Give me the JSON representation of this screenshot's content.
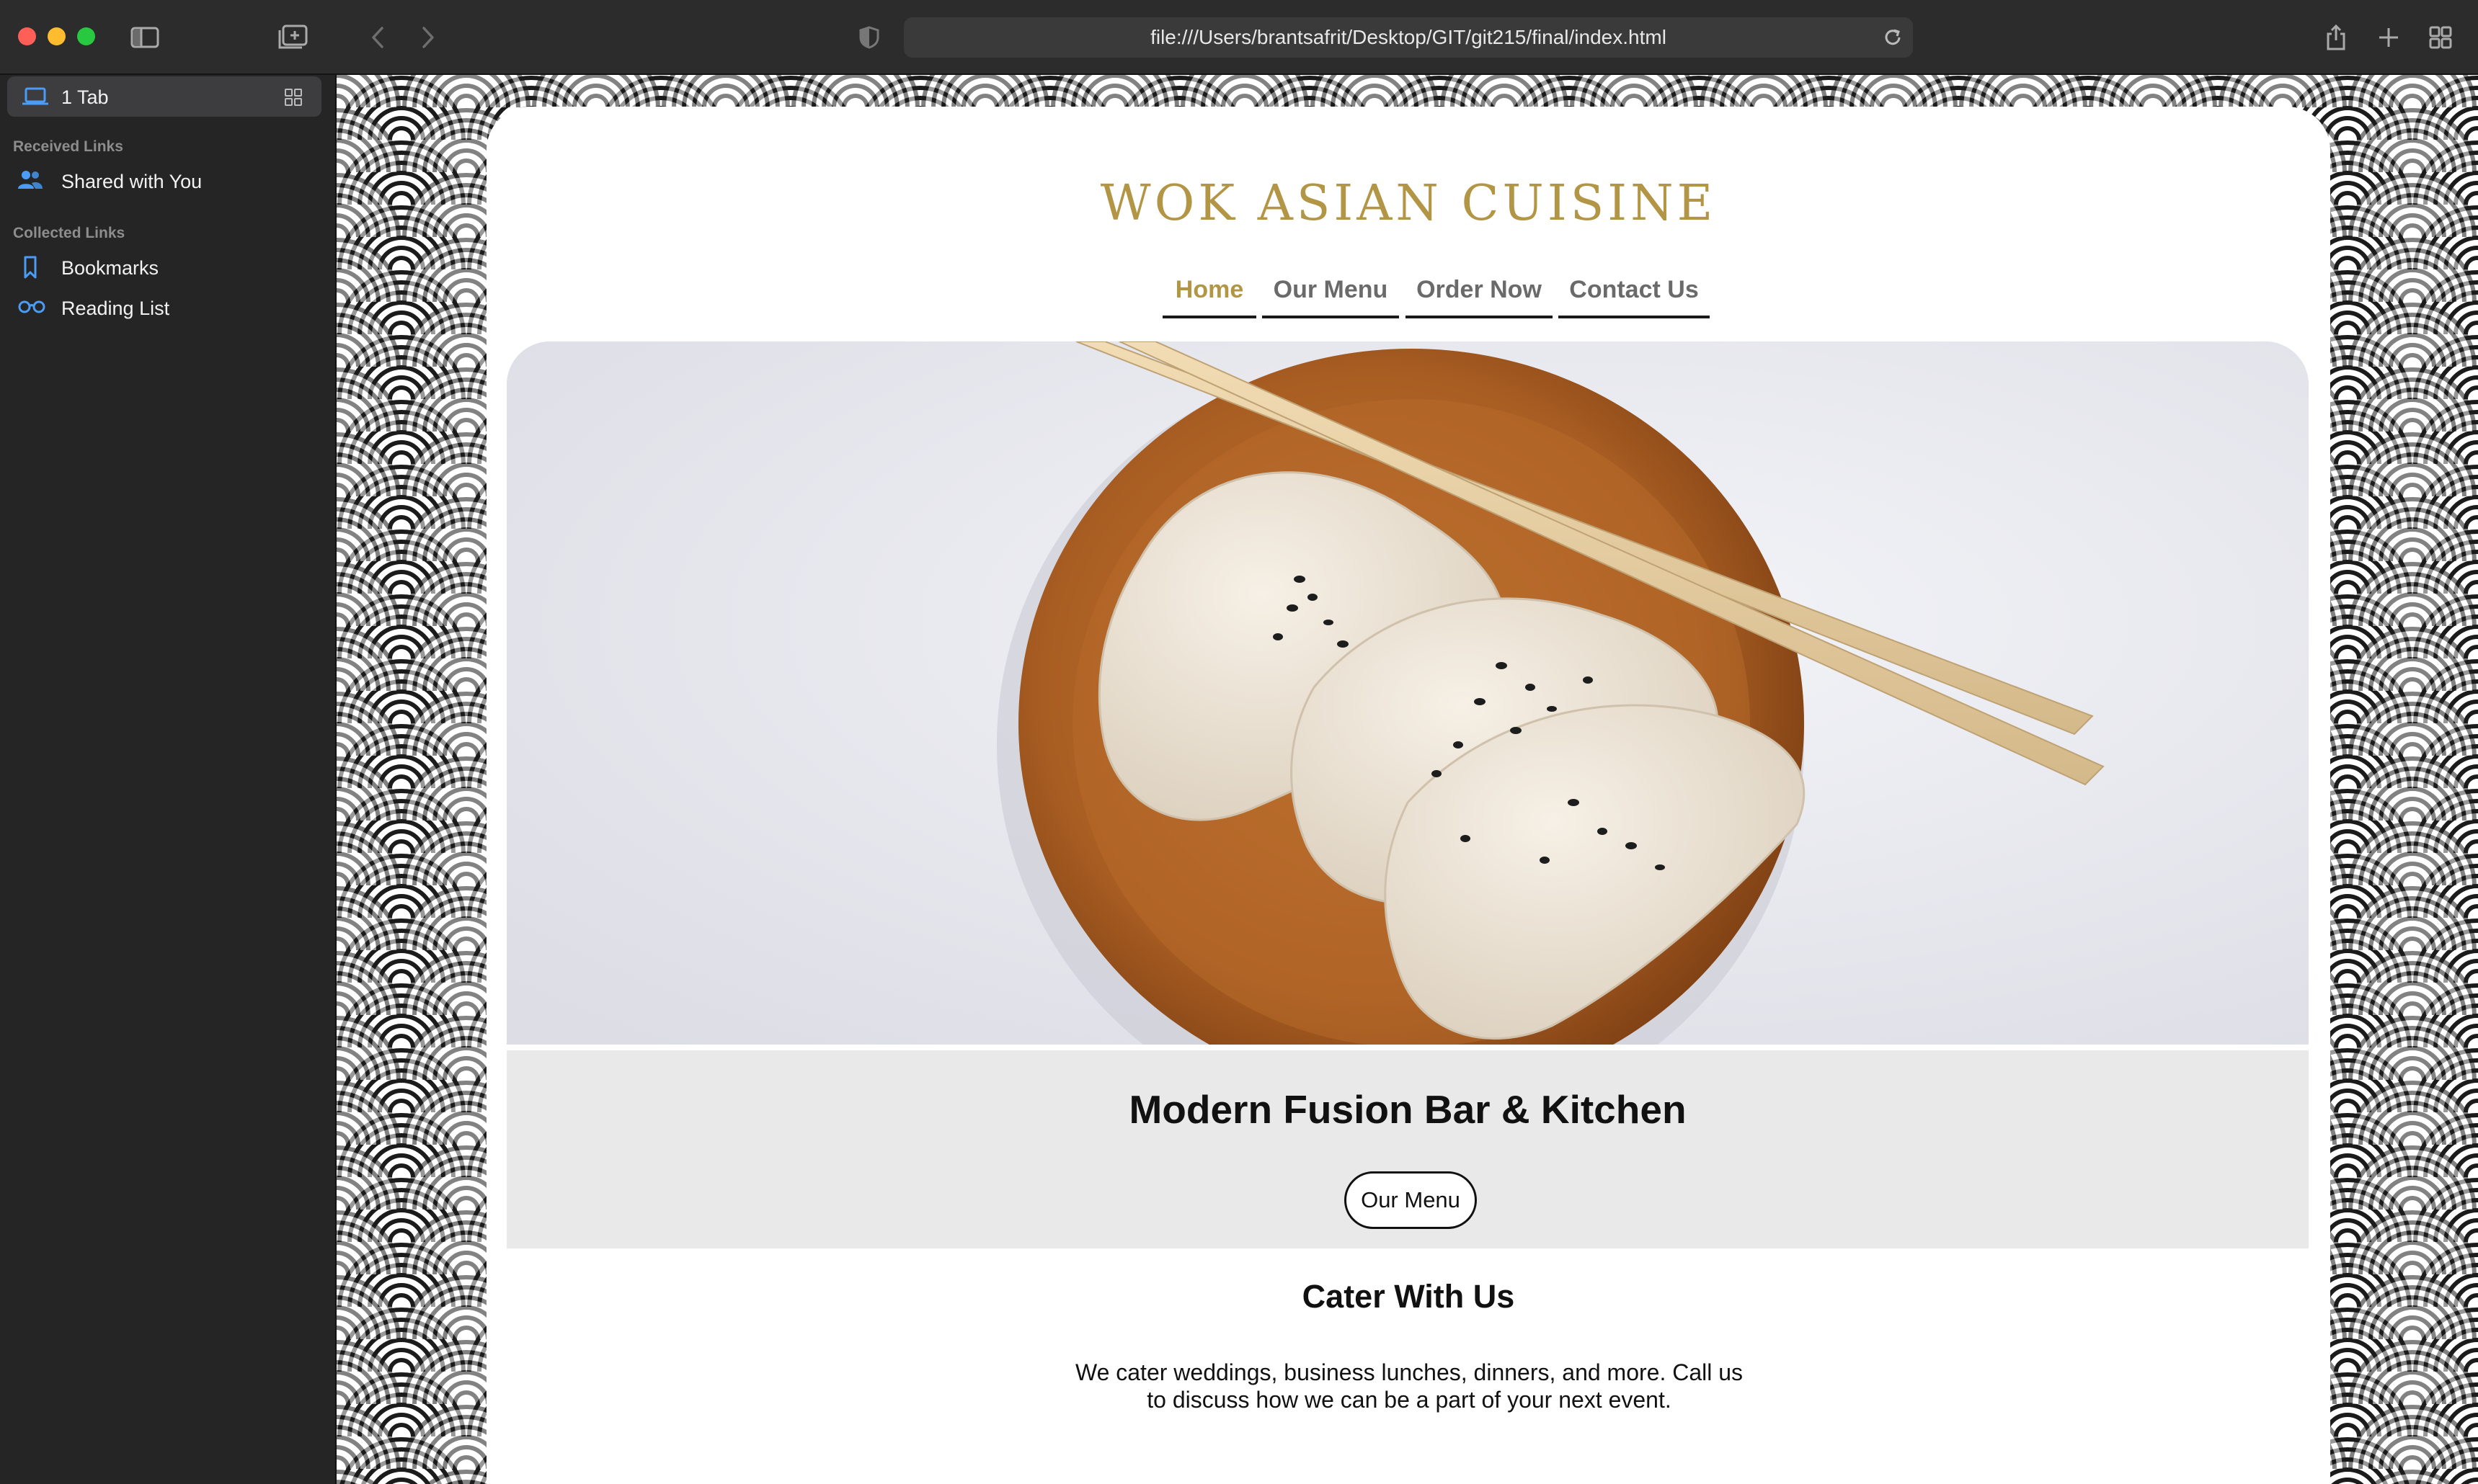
{
  "browser": {
    "url": "file:///Users/brantsafrit/Desktop/GIT/git215/final/index.html"
  },
  "sidebar": {
    "tab_label": "1 Tab",
    "received_heading": "Received Links",
    "shared_label": "Shared with You",
    "collected_heading": "Collected Links",
    "bookmarks_label": "Bookmarks",
    "reading_list_label": "Reading List"
  },
  "site": {
    "title": "WOK ASIAN CUISINE",
    "nav": [
      {
        "label": "Home",
        "active": true
      },
      {
        "label": "Our Menu",
        "active": false
      },
      {
        "label": "Order Now",
        "active": false
      },
      {
        "label": "Contact Us",
        "active": false
      }
    ],
    "hero_heading": "Modern Fusion Bar & Kitchen",
    "hero_button": "Our Menu",
    "cater_title": "Cater With Us",
    "cater_text": "We cater weddings, business lunches, dinners, and more. Call us to discuss how we can be a part of your next event."
  },
  "colors": {
    "brand_gold": "#b39645",
    "nav_inactive": "#6a6a6a",
    "band_gray": "#e9e9e9"
  },
  "icons": [
    "sidebar-toggle-icon",
    "new-tab-group-icon",
    "back-icon",
    "forward-icon",
    "privacy-shield-icon",
    "reload-icon",
    "share-icon",
    "new-tab-icon",
    "tab-overview-icon",
    "laptop-icon",
    "tab-grid-icon",
    "shared-people-icon",
    "bookmark-icon",
    "reading-list-icon"
  ]
}
